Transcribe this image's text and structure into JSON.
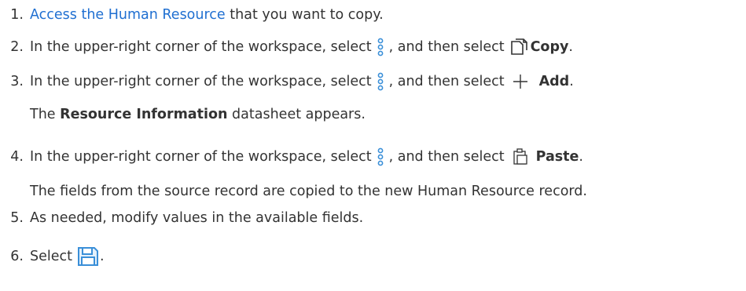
{
  "steps": [
    {
      "number": "1.",
      "link_text": "Access the Human Resource",
      "text_after": "that you want to copy."
    },
    {
      "number": "2.",
      "text_before": "In the upper-right corner of the workspace, select",
      "text_mid": ", and then select",
      "action_label": "Copy",
      "icons": [
        "more-vertical-icon",
        "copy-icon"
      ]
    },
    {
      "number": "3.",
      "text_before": "In the upper-right corner of the workspace, select",
      "text_mid": ", and then select",
      "action_label": "Add",
      "icons": [
        "more-vertical-icon",
        "plus-icon"
      ]
    },
    {
      "note_bold": "Resource Information",
      "note_rest": "datasheet appears."
    },
    {
      "number": "4.",
      "text_before": "In the upper-right corner of the workspace, select",
      "text_mid": ", and then select",
      "action_label": "Paste",
      "icons": [
        "more-vertical-icon",
        "paste-icon"
      ]
    },
    {
      "note_text": "The fields from the source record are copied to the new Human Resource record."
    },
    {
      "number": "5.",
      "text": "As needed, modify values in the available fields."
    },
    {
      "number": "6.",
      "text_before": "Select",
      "text_after": ".",
      "icons": [
        "save-icon"
      ]
    }
  ],
  "colors": {
    "text": "#333333",
    "link": "#1f6fd1",
    "icon_blue": "#3a8fd8",
    "icon_dark": "#333333"
  }
}
